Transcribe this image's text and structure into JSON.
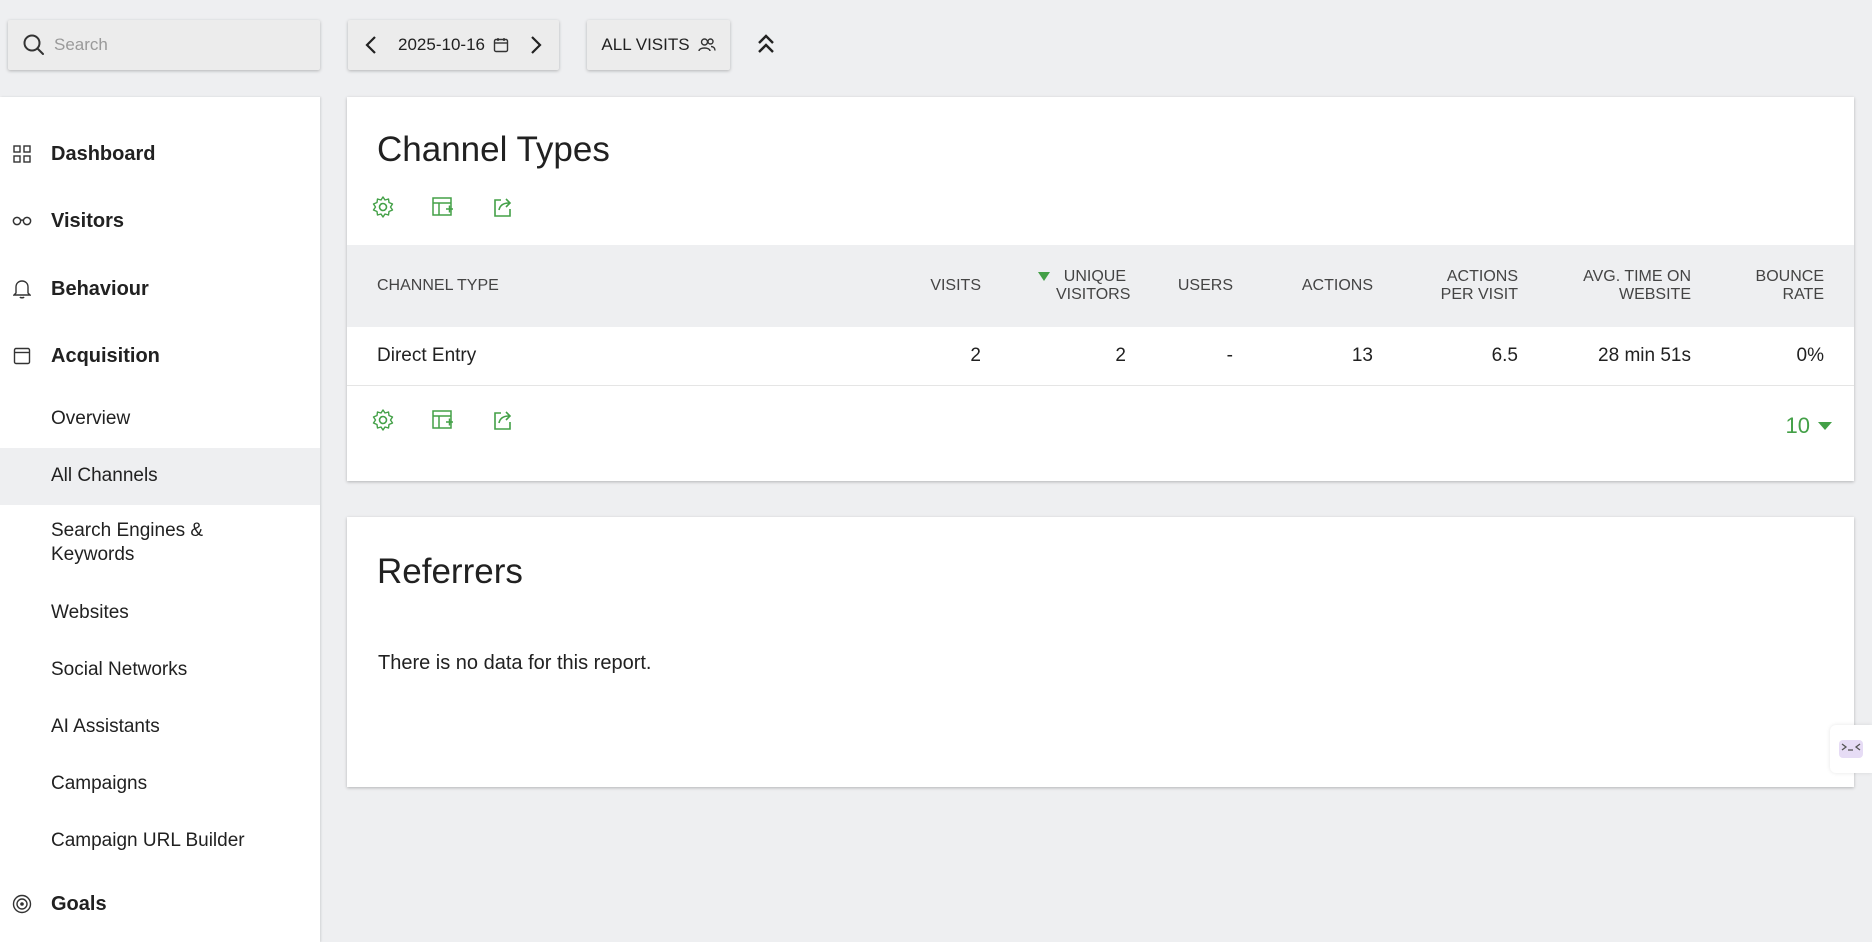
{
  "search": {
    "placeholder": "Search"
  },
  "period": {
    "date": "2025-10-16"
  },
  "segment": {
    "label": "ALL VISITS"
  },
  "sidebar": {
    "main_items": [
      {
        "label": "Dashboard",
        "icon": "grid-icon"
      },
      {
        "label": "Visitors",
        "icon": "binoculars-icon"
      },
      {
        "label": "Behaviour",
        "icon": "bell-icon"
      },
      {
        "label": "Acquisition",
        "icon": "window-icon"
      },
      {
        "label": "Goals",
        "icon": "target-icon"
      }
    ],
    "sub_items": [
      {
        "label": "Overview"
      },
      {
        "label": "All Channels",
        "active": true
      },
      {
        "label": "Search Engines & Keywords"
      },
      {
        "label": "Websites"
      },
      {
        "label": "Social Networks"
      },
      {
        "label": "AI Assistants"
      },
      {
        "label": "Campaigns"
      },
      {
        "label": "Campaign URL Builder"
      }
    ]
  },
  "channel_types": {
    "title": "Channel Types",
    "columns": [
      {
        "label": "CHANNEL TYPE"
      },
      {
        "label": "VISITS"
      },
      {
        "label": "UNIQUE VISITORS",
        "sorted": "desc"
      },
      {
        "label": "USERS"
      },
      {
        "label": "ACTIONS"
      },
      {
        "label": "ACTIONS PER VISIT"
      },
      {
        "label": "AVG. TIME ON WEBSITE"
      },
      {
        "label": "BOUNCE RATE"
      }
    ],
    "rows": [
      {
        "channel": "Direct Entry",
        "visits": "2",
        "unique_visitors": "2",
        "users": "-",
        "actions": "13",
        "actions_per_visit": "6.5",
        "avg_time": "28 min 51s",
        "bounce_rate": "0%"
      }
    ],
    "limit": "10"
  },
  "referrers": {
    "title": "Referrers",
    "empty_message": "There is no data for this report."
  },
  "colors": {
    "accent": "#43a047",
    "background": "#eeeff1"
  }
}
